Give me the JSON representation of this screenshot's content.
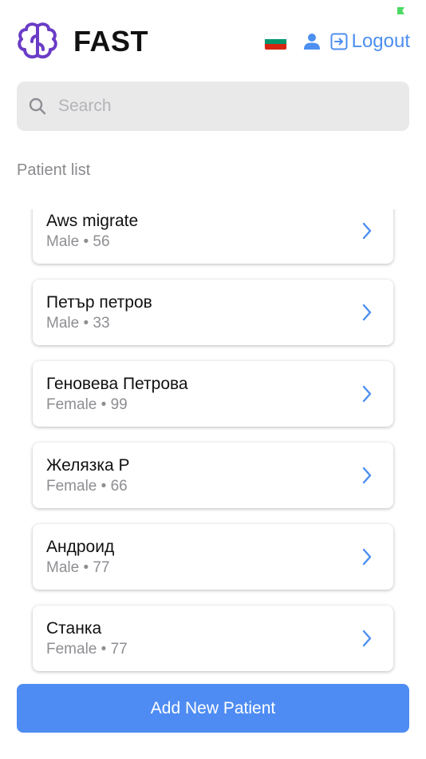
{
  "header": {
    "brand": "FAST",
    "logout_label": "Logout"
  },
  "flag_colors": [
    "#ffffff",
    "#00966e",
    "#d62612"
  ],
  "colors": {
    "accent": "#4e8cf3",
    "link": "#4c8ff0",
    "logo": "#6a3cc6"
  },
  "icons": {
    "logo": "brain-logo-icon",
    "user": "user-icon",
    "logout": "logout-icon",
    "search": "search-icon",
    "chevron": "chevron-right-icon"
  },
  "search": {
    "placeholder": "Search"
  },
  "section_title": "Patient list",
  "patients": [
    {
      "name": "Aws migrate",
      "meta": "Male • 56"
    },
    {
      "name": "Петър петров",
      "meta": "Male • 33"
    },
    {
      "name": "Геновева Петрова",
      "meta": "Female • 99"
    },
    {
      "name": "Желязка Р",
      "meta": "Female • 66"
    },
    {
      "name": "Андроид",
      "meta": "Male • 77"
    },
    {
      "name": "Станка",
      "meta": "Female • 77"
    }
  ],
  "add_button_label": "Add New Patient"
}
